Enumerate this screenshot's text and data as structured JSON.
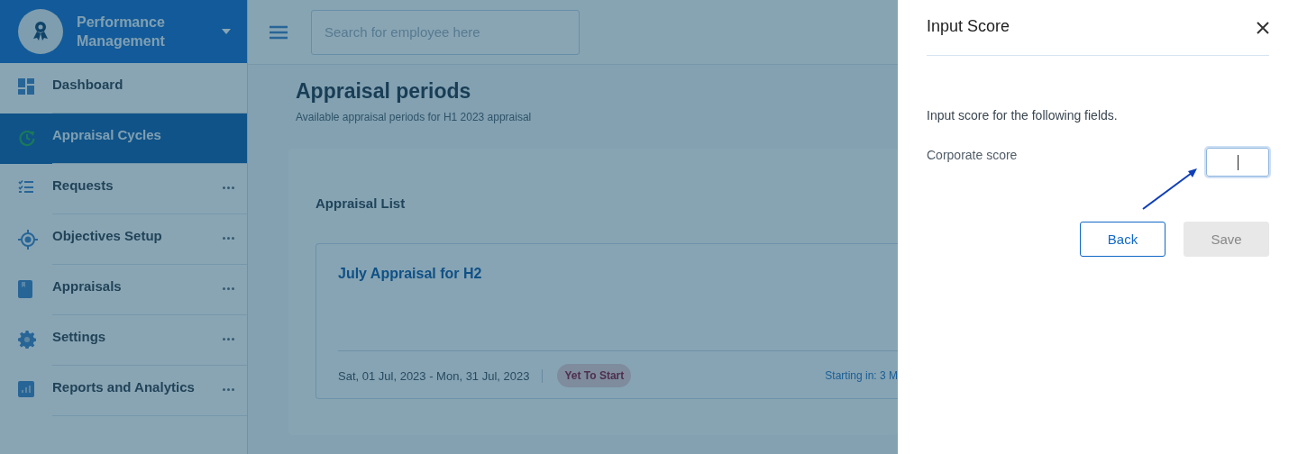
{
  "app": {
    "title": "Performance Management"
  },
  "sidebar": {
    "items": [
      {
        "label": "Dashboard",
        "selected": false,
        "more": false
      },
      {
        "label": "Appraisal Cycles",
        "selected": true,
        "more": false
      },
      {
        "label": "Requests",
        "selected": false,
        "more": true
      },
      {
        "label": "Objectives Setup",
        "selected": false,
        "more": true
      },
      {
        "label": "Appraisals",
        "selected": false,
        "more": true
      },
      {
        "label": "Settings",
        "selected": false,
        "more": true
      },
      {
        "label": "Reports and Analytics",
        "selected": false,
        "more": true
      }
    ]
  },
  "search": {
    "placeholder": "Search for employee here"
  },
  "page": {
    "title": "Appraisal periods",
    "subtitle": "Available appraisal periods for H1 2023 appraisal"
  },
  "list": {
    "title": "Appraisal List",
    "cards": [
      {
        "title": "July Appraisal for H2",
        "dates": "Sat, 01 Jul, 2023 - Mon, 31 Jul, 2023",
        "status": "Yet To Start",
        "countdown": "Starting in: 3 M"
      }
    ]
  },
  "dialog": {
    "title": "Input Score",
    "instruction": "Input score for the following fields.",
    "fields": [
      {
        "label": "Corporate score",
        "focused": true
      }
    ],
    "buttons": [
      {
        "label": "Back",
        "kind": "outline",
        "disabled": false
      },
      {
        "label": "Save",
        "kind": "filled",
        "disabled": true
      }
    ]
  }
}
